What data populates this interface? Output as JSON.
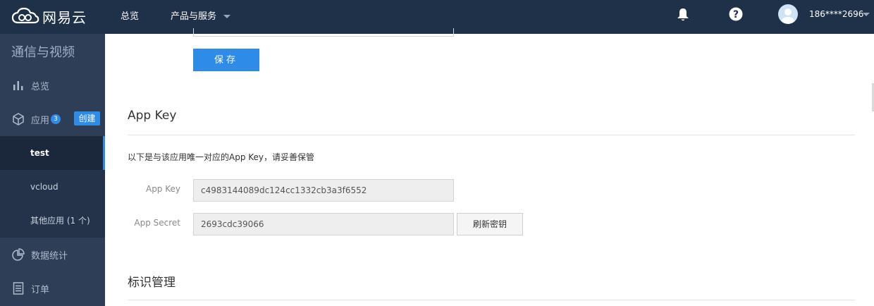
{
  "topbar": {
    "logo_text": "网易云",
    "nav": [
      {
        "label": "总览"
      },
      {
        "label": "产品与服务"
      }
    ],
    "user_name": "186****2696"
  },
  "sidebar": {
    "title": "通信与视频",
    "overview_label": "总览",
    "apps_label": "应用",
    "apps_badge": "3",
    "create_label": "创建",
    "sub_items": [
      {
        "label": "test",
        "active": true
      },
      {
        "label": "vcloud"
      },
      {
        "label": "其他应用 (1 个)"
      }
    ],
    "stats_label": "数据统计",
    "orders_label": "订单"
  },
  "main": {
    "save_label": "保存",
    "appkey_section_title": "App Key",
    "description": "以下是与该应用唯一对应的App Key，请妥善保管",
    "appkey_label": "App Key",
    "appkey_value": "c4983144089dc124cc1332cb3a3f6552",
    "secret_label": "App Secret",
    "secret_value": "2693cdc39066",
    "refresh_label": "刷新密钥",
    "ident_section_title": "标识管理"
  },
  "colors": {
    "topbar_bg": "#1f3049",
    "sidebar_bg": "#2d3e56",
    "accent": "#2f8be8"
  }
}
